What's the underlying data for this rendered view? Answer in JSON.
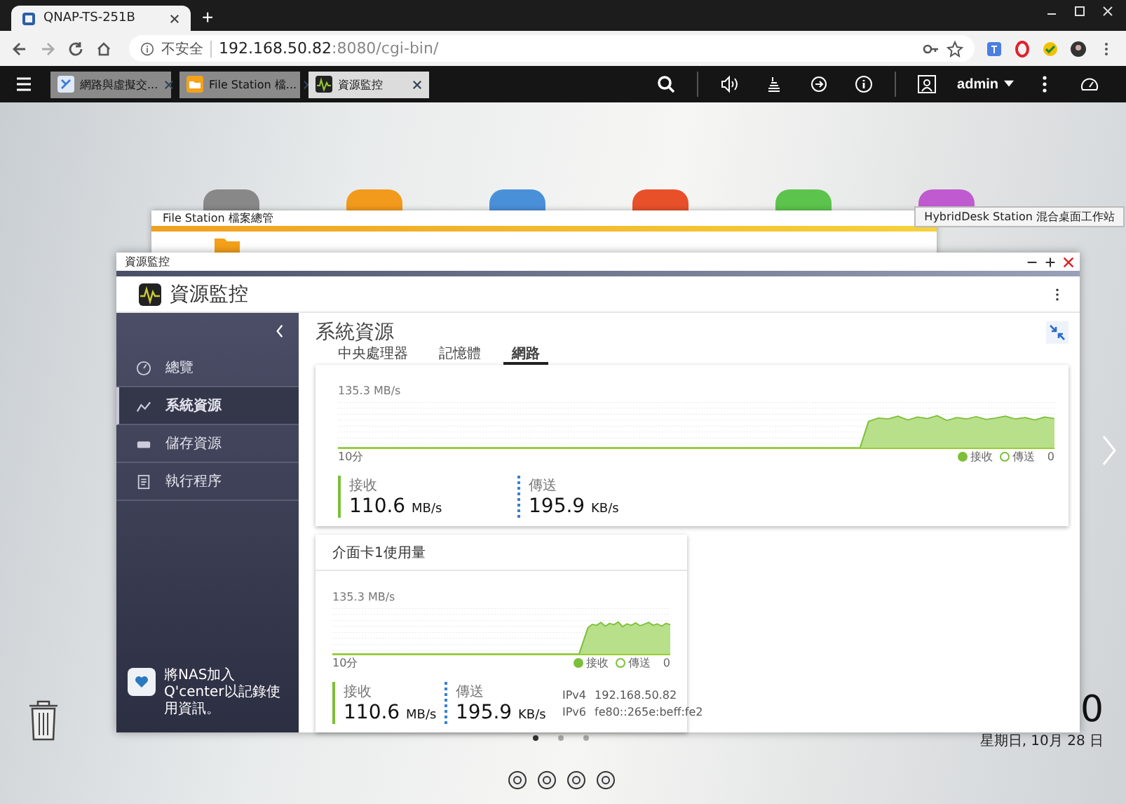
{
  "browser": {
    "tab_title": "QNAP-TS-251B",
    "new_tab": "+",
    "security": "不安全",
    "url_host": "192.168.50.82",
    "url_path": ":8080/cgi-bin/"
  },
  "toolbar": {
    "app_tabs": [
      {
        "label": "網路與虛擬交...",
        "kind": "network",
        "selected": false
      },
      {
        "label": "File Station 檔...",
        "kind": "folder",
        "selected": false
      },
      {
        "label": "資源監控",
        "kind": "monitor",
        "selected": true
      }
    ],
    "user": "admin"
  },
  "desktop": {
    "tooltip": "HybridDesk Station 混合桌面工作站",
    "clock": "0",
    "date": "星期日, 10月 28 日",
    "pages": [
      {
        "selected": true
      },
      {
        "selected": false
      },
      {
        "selected": false
      }
    ]
  },
  "file_station": {
    "title": "File Station 檔案總管"
  },
  "monitor": {
    "title": "資源監控",
    "app_name": "資源監控",
    "nav": [
      {
        "label": "總覽",
        "kind": "overview",
        "selected": false
      },
      {
        "label": "系統資源",
        "kind": "system",
        "selected": true
      },
      {
        "label": "儲存資源",
        "kind": "storage",
        "selected": false
      },
      {
        "label": "執行程序",
        "kind": "process",
        "selected": false
      }
    ],
    "notice": "將NAS加入Q'center以記錄使用資訊。",
    "section_title": "系統資源",
    "tabs": [
      {
        "label": "中央處理器",
        "selected": false
      },
      {
        "label": "記憶體",
        "selected": false
      },
      {
        "label": "網路",
        "selected": true
      }
    ],
    "cards": [
      {
        "max": "135.3 MB/s",
        "span": "10分",
        "zero": "0",
        "legend": [
          {
            "label": "接收",
            "kind": "filled"
          },
          {
            "label": "傳送",
            "kind": "hollow"
          }
        ],
        "stats": [
          {
            "label": "接收",
            "value": "110.6",
            "unit": "MB/s",
            "kind": "solid"
          },
          {
            "label": "傳送",
            "value": "195.9",
            "unit": "KB/s",
            "kind": "dotted"
          }
        ]
      },
      {
        "title": "介面卡1使用量",
        "max": "135.3 MB/s",
        "span": "10分",
        "zero": "0",
        "legend": [
          {
            "label": "接收",
            "kind": "filled"
          },
          {
            "label": "傳送",
            "kind": "hollow"
          }
        ],
        "stats": [
          {
            "label": "接收",
            "value": "110.6",
            "unit": "MB/s",
            "kind": "solid"
          },
          {
            "label": "傳送",
            "value": "195.9",
            "unit": "KB/s",
            "kind": "dotted"
          }
        ],
        "addresses": [
          {
            "label": "IPv4",
            "value": "192.168.50.82"
          },
          {
            "label": "IPv6",
            "value": "fe80::265e:beff:fe2"
          }
        ]
      }
    ]
  }
}
